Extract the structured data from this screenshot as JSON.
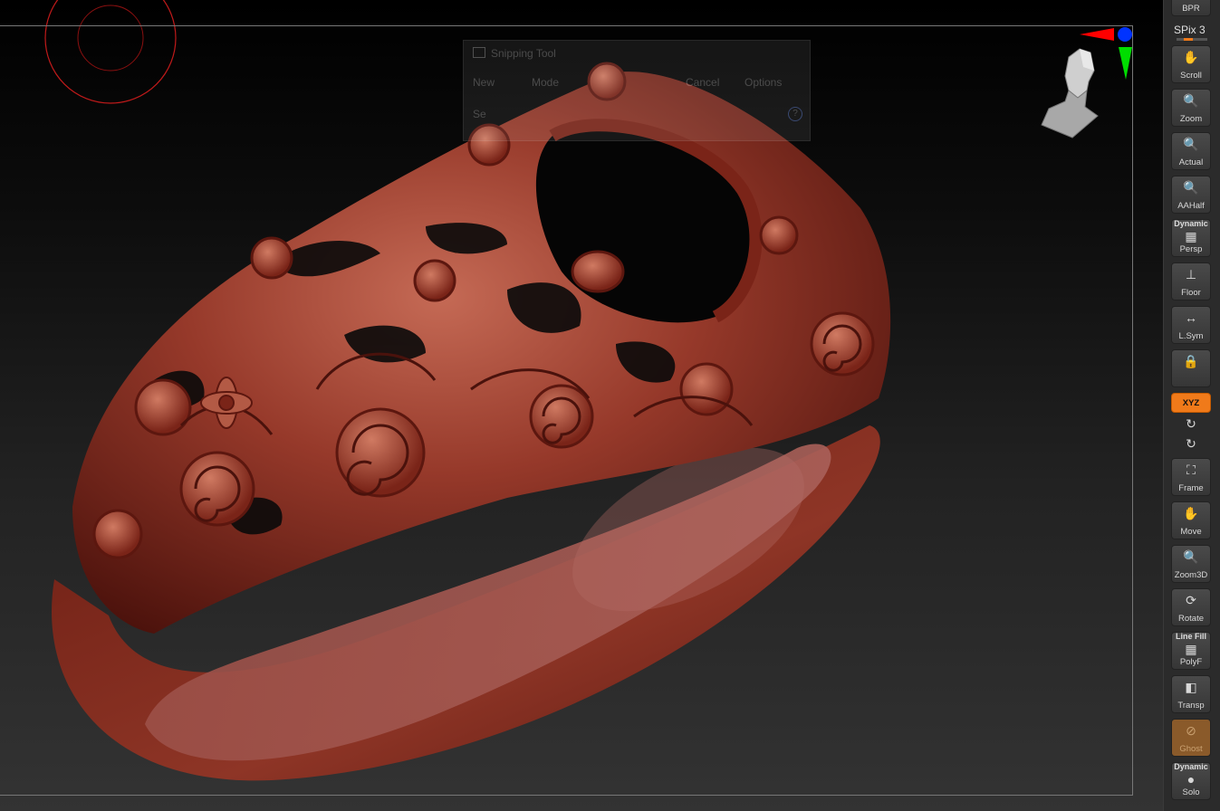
{
  "snipping_tool": {
    "title": "Snipping Tool",
    "new_label": "New",
    "mode_label": "Mode",
    "cancel_label": "Cancel",
    "options_label": "Options",
    "hint_text": "Se",
    "help_glyph": "?"
  },
  "shelf": {
    "bpr_label": "BPR",
    "spix_label": "SPix 3",
    "spix_value": 3,
    "tools": [
      {
        "id": "scroll",
        "label": "Scroll",
        "icon": "hand-scroll-icon"
      },
      {
        "id": "zoom",
        "label": "Zoom",
        "icon": "magnifier-zoom-icon"
      },
      {
        "id": "actual",
        "label": "Actual",
        "icon": "magnifier-actual-icon"
      },
      {
        "id": "aahalf",
        "label": "AAHalf",
        "icon": "magnifier-aahalf-icon"
      },
      {
        "id": "persp",
        "label": "Persp",
        "top_label": "Dynamic",
        "icon": "perspective-grid-icon"
      },
      {
        "id": "floor",
        "label": "Floor",
        "icon": "floor-grid-icon"
      },
      {
        "id": "lsym",
        "label": "L.Sym",
        "icon": "local-symmetry-icon"
      },
      {
        "id": "lock",
        "label": "",
        "icon": "camera-lock-icon"
      },
      {
        "id": "xyz",
        "label": "XYZ",
        "icon": "rotate-xyz-icon",
        "active": true
      },
      {
        "id": "rot-y",
        "label": "",
        "icon": "rotate-y-icon"
      },
      {
        "id": "rot-z",
        "label": "",
        "icon": "rotate-z-icon"
      },
      {
        "id": "frame",
        "label": "Frame",
        "icon": "frame-icon"
      },
      {
        "id": "move",
        "label": "Move",
        "icon": "hand-move-icon"
      },
      {
        "id": "zoom3d",
        "label": "Zoom3D",
        "icon": "zoom3d-icon"
      },
      {
        "id": "rotate",
        "label": "Rotate",
        "icon": "rotate-icon"
      },
      {
        "id": "polyf",
        "label": "PolyF",
        "top_label": "Line Fill",
        "icon": "polyframe-icon"
      },
      {
        "id": "transp",
        "label": "Transp",
        "icon": "transparency-icon"
      },
      {
        "id": "ghost",
        "label": "Ghost",
        "icon": "ghost-icon",
        "ghost": true
      },
      {
        "id": "solo",
        "label": "Solo",
        "top_label": "Dynamic",
        "icon": "solo-icon"
      }
    ]
  },
  "colors": {
    "accent": "#f07a1a",
    "model": "#8a2a1c",
    "axis_x": "#ff0000",
    "axis_y": "#00dd00",
    "axis_z": "#0033ff"
  }
}
